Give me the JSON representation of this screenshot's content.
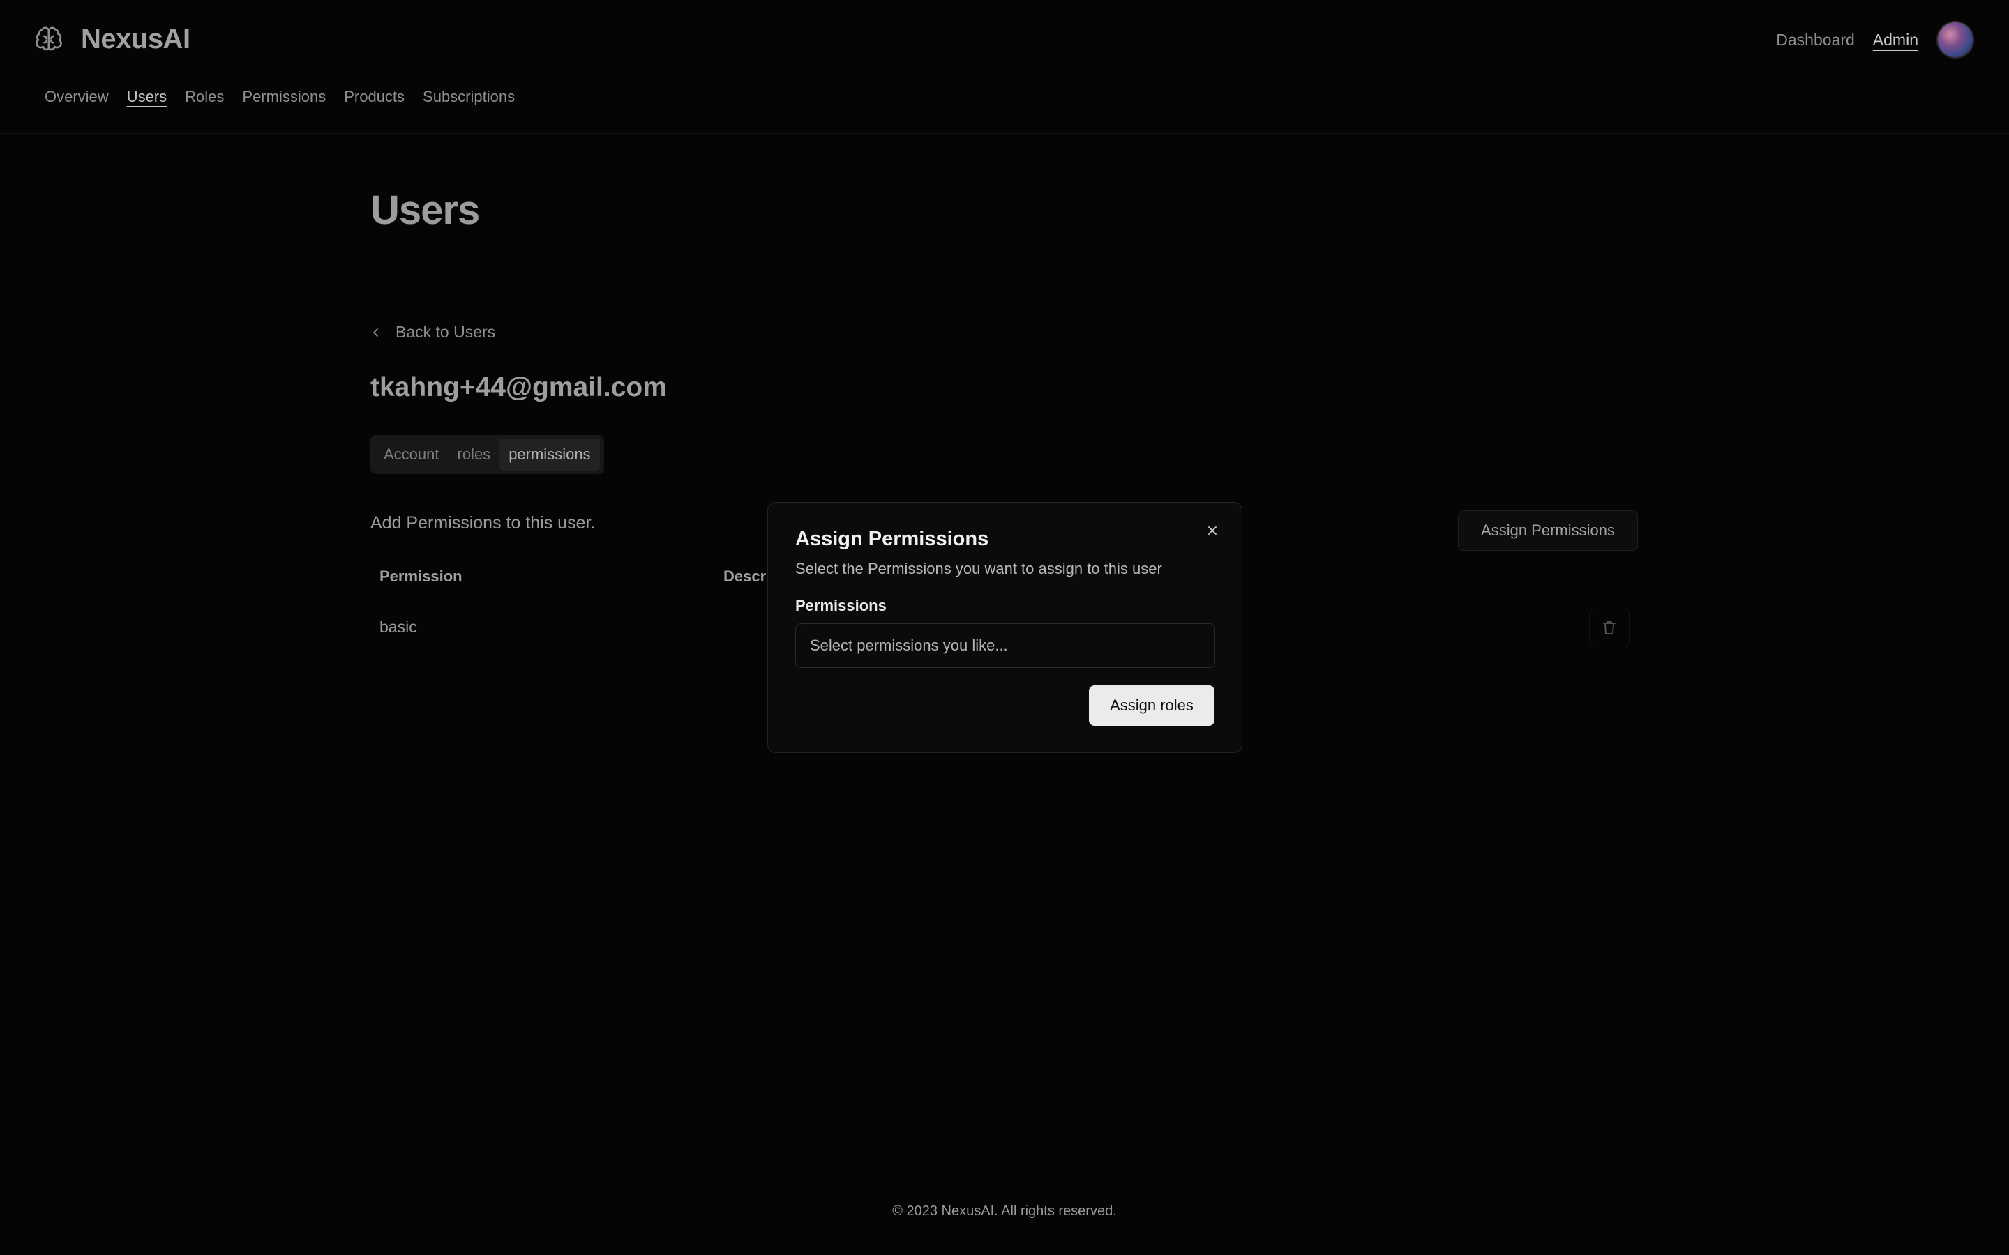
{
  "header": {
    "brand": "NexusAI",
    "brand_icon": "brain-icon",
    "nav": [
      {
        "label": "Overview",
        "active": false
      },
      {
        "label": "Users",
        "active": true
      },
      {
        "label": "Roles",
        "active": false
      },
      {
        "label": "Permissions",
        "active": false
      },
      {
        "label": "Products",
        "active": false
      },
      {
        "label": "Subscriptions",
        "active": false
      }
    ],
    "top_links": [
      {
        "label": "Dashboard",
        "active": false
      },
      {
        "label": "Admin",
        "active": true
      }
    ]
  },
  "page": {
    "title": "Users",
    "back_label": "Back to Users",
    "email": "tkahng+44@gmail.com",
    "tabs": [
      {
        "label": "Account",
        "active": false
      },
      {
        "label": "roles",
        "active": false
      },
      {
        "label": "permissions",
        "active": true
      }
    ],
    "section_desc": "Add Permissions to this user.",
    "assign_button": "Assign Permissions",
    "table": {
      "columns": [
        "Permission",
        "Descr"
      ],
      "rows": [
        {
          "permission": "basic"
        }
      ]
    }
  },
  "modal": {
    "title": "Assign Permissions",
    "description": "Select the Permissions you want to assign to this user",
    "field_label": "Permissions",
    "field_placeholder": "Select permissions you like...",
    "submit_label": "Assign roles"
  },
  "footer": {
    "text": "© 2023 NexusAI. All rights reserved."
  }
}
